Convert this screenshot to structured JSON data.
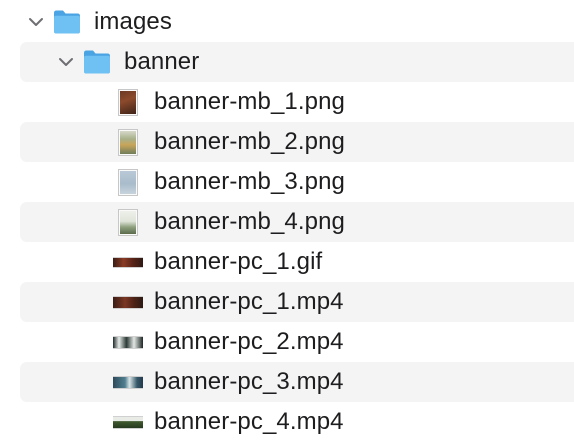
{
  "tree": {
    "folder_images": {
      "label": "images",
      "expanded": true,
      "icon": "folder-icon",
      "color": "#5ab4ec"
    },
    "folder_banner": {
      "label": "banner",
      "expanded": true,
      "icon": "folder-icon",
      "color": "#5ab4ec"
    },
    "files": [
      {
        "label": "banner-mb_1.png",
        "thumb": "portrait-dark-brown"
      },
      {
        "label": "banner-mb_2.png",
        "thumb": "portrait-illustration"
      },
      {
        "label": "banner-mb_3.png",
        "thumb": "portrait-light-blue"
      },
      {
        "label": "banner-mb_4.png",
        "thumb": "portrait-light-green"
      },
      {
        "label": "banner-pc_1.gif",
        "thumb": "wide-dark-red"
      },
      {
        "label": "banner-pc_1.mp4",
        "thumb": "wide-dark-red"
      },
      {
        "label": "banner-pc_2.mp4",
        "thumb": "wide-white-dark"
      },
      {
        "label": "banner-pc_3.mp4",
        "thumb": "wide-teal"
      },
      {
        "label": "banner-pc_4.mp4",
        "thumb": "wide-green-dark"
      }
    ]
  },
  "colors": {
    "stripe": "#f4f4f5",
    "text": "#1d1d1f",
    "chevron": "#6e6e73"
  }
}
